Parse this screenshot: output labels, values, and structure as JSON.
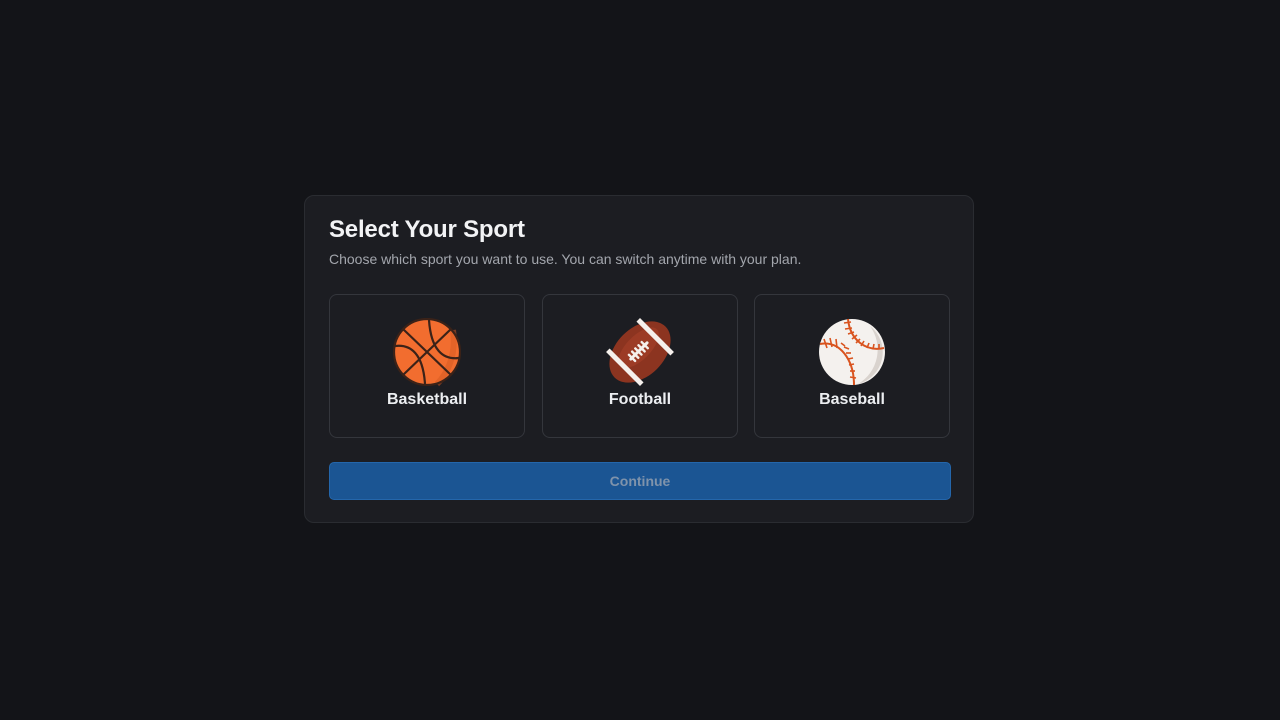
{
  "dialog": {
    "title": "Select Your Sport",
    "subtitle": "Choose which sport you want to use. You can switch anytime with your plan."
  },
  "sports": [
    {
      "label": "Basketball",
      "icon": "basketball-icon"
    },
    {
      "label": "Football",
      "icon": "football-icon"
    },
    {
      "label": "Baseball",
      "icon": "baseball-icon"
    }
  ],
  "actions": {
    "continue_label": "Continue"
  },
  "colors": {
    "background": "#131418",
    "panel": "#1c1d22",
    "accent": "#1b5593",
    "basketball": "#f26d2f",
    "football": "#8c3420",
    "baseball_stitch": "#d9531e"
  }
}
